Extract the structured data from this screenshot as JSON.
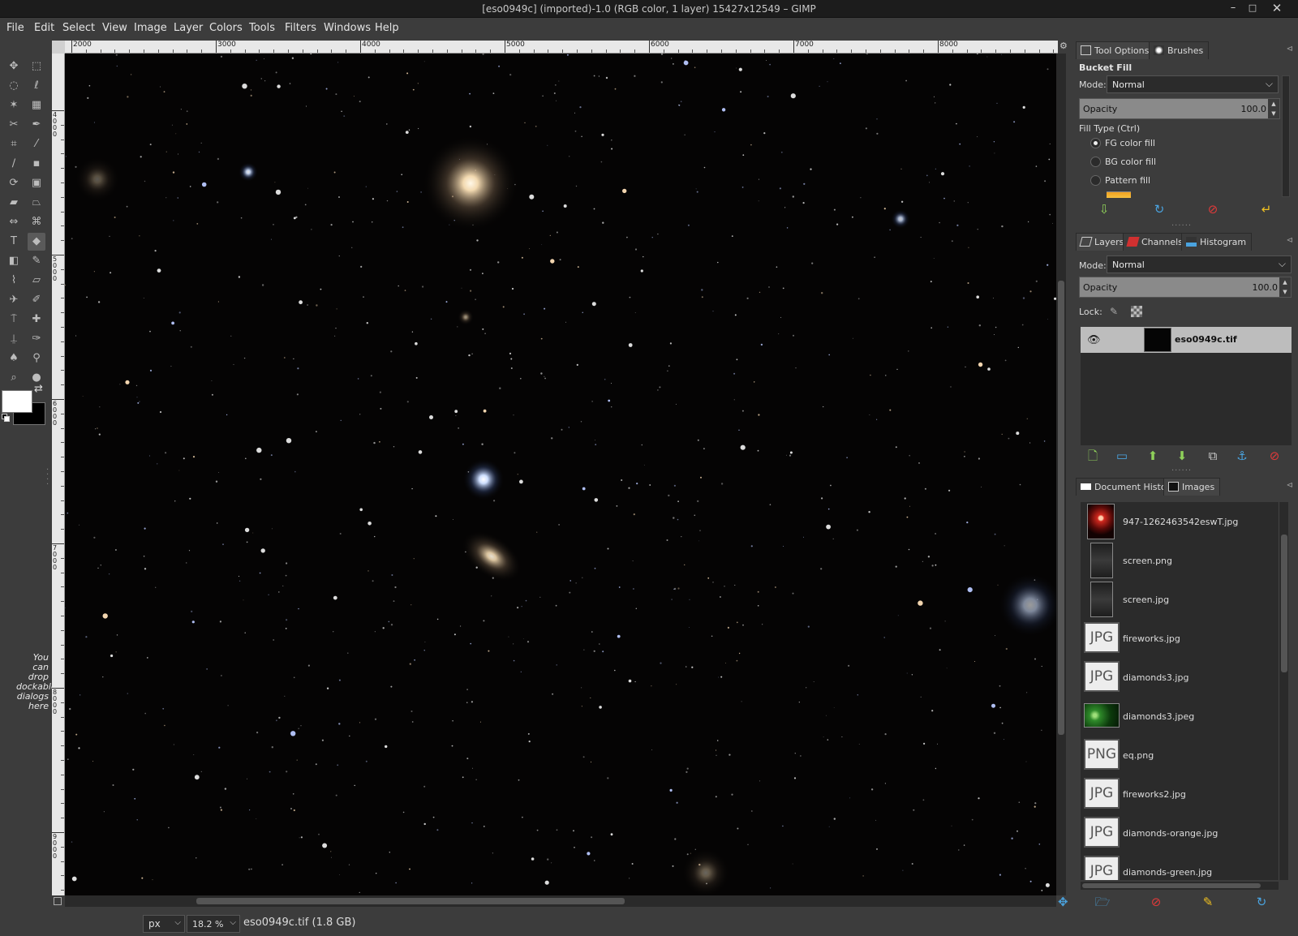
{
  "window": {
    "title": "[eso0949c] (imported)-1.0 (RGB color, 1 layer) 15427x12549 – GIMP",
    "minimize": "–",
    "maximize": "□",
    "close": "✕"
  },
  "menu": [
    "File",
    "Edit",
    "Select",
    "View",
    "Image",
    "Layer",
    "Colors",
    "Tools",
    "Filters",
    "Windows",
    "Help"
  ],
  "toolbox": {
    "drop_hint": "You can drop dockable dialogs here"
  },
  "ruler": {
    "top_labels": [
      "2000",
      "3000",
      "4000",
      "5000",
      "6000",
      "7000",
      "8000"
    ],
    "left_labels": [
      "4000",
      "5000",
      "6000",
      "7000",
      "8000",
      "9000"
    ]
  },
  "statusbar": {
    "unit": "px",
    "zoom": "18.2 %",
    "info": "eso0949c.tif (1.8 GB)"
  },
  "tool_options": {
    "tabs": [
      "Tool Options",
      "Brushes"
    ],
    "title": "Bucket Fill",
    "mode_label": "Mode:",
    "mode_value": "Normal",
    "opacity_label": "Opacity",
    "opacity_value": "100.0",
    "fill_type_label": "Fill Type  (Ctrl)",
    "fill_types": [
      {
        "label": "FG color fill",
        "checked": true
      },
      {
        "label": "BG color fill",
        "checked": false
      },
      {
        "label": "Pattern fill",
        "checked": false
      }
    ]
  },
  "layers": {
    "tabs": [
      "Layers",
      "Channels",
      "Histogram"
    ],
    "mode_label": "Mode:",
    "mode_value": "Normal",
    "opacity_label": "Opacity",
    "opacity_value": "100.0",
    "lock_label": "Lock:",
    "items": [
      {
        "name": "eso0949c.tif",
        "visible": true
      }
    ]
  },
  "images": {
    "tabs": [
      "Document History",
      "Images"
    ],
    "items": [
      {
        "name": "947-1262463542eswT.jpg",
        "thumb": "photo-red",
        "label": ""
      },
      {
        "name": "screen.png",
        "thumb": "photo-phone",
        "label": ""
      },
      {
        "name": "screen.jpg",
        "thumb": "photo-phone",
        "label": ""
      },
      {
        "name": "fireworks.jpg",
        "thumb": "file",
        "label": "JPG"
      },
      {
        "name": "diamonds3.jpg",
        "thumb": "file",
        "label": "JPG"
      },
      {
        "name": "diamonds3.jpeg",
        "thumb": "photo-green",
        "label": ""
      },
      {
        "name": "eq.png",
        "thumb": "file",
        "label": "PNG"
      },
      {
        "name": "fireworks2.jpg",
        "thumb": "file",
        "label": "JPG"
      },
      {
        "name": "diamonds-orange.jpg",
        "thumb": "file",
        "label": "JPG"
      },
      {
        "name": "diamonds-green.jpg",
        "thumb": "file",
        "label": "JPG"
      }
    ]
  },
  "colors": {
    "foreground": "#ffffff",
    "background": "#000000",
    "accent_blue": "#4aa3df",
    "delete_red": "#e03a3a",
    "arrow_green": "#8fd05a",
    "canvas": "#050404"
  }
}
